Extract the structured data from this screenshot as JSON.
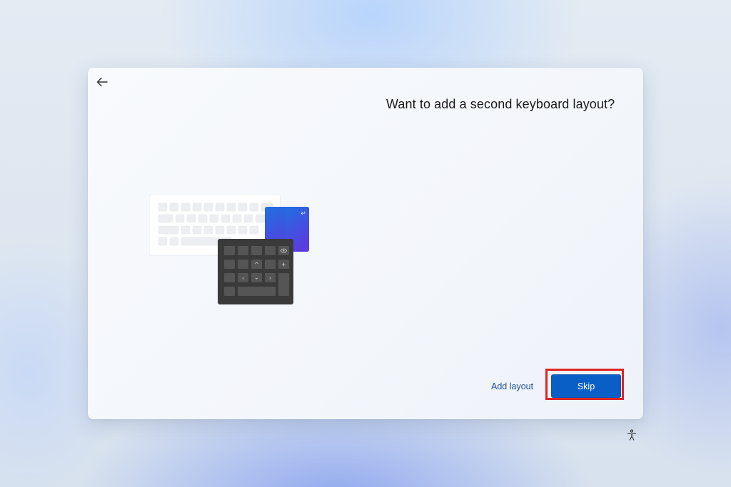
{
  "setup": {
    "back_icon": "back-arrow-icon",
    "title": "Want to add a second keyboard layout?",
    "illustration": {
      "keypad_symbols": {
        "enter": "↵",
        "up": "^",
        "down": "⌄",
        "left": "‹",
        "right": "›",
        "plus": "+"
      }
    },
    "actions": {
      "add_layout_label": "Add layout",
      "skip_label": "Skip"
    },
    "accessibility_icon": "accessibility-icon"
  },
  "colors": {
    "accent": "#0a5fc6",
    "link": "#1a4f9c",
    "highlight": "#e02424"
  }
}
